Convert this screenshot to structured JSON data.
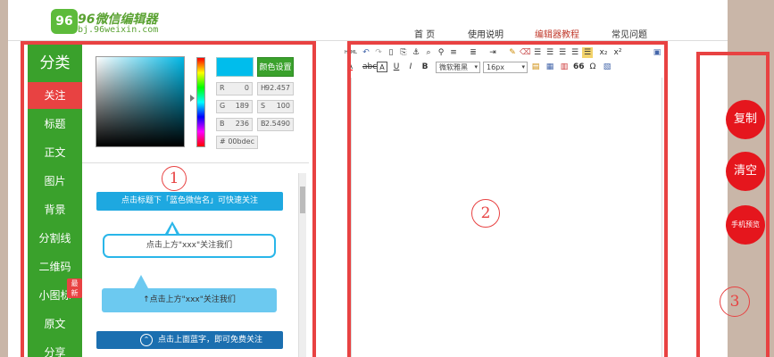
{
  "logo": {
    "main": "96微信编辑器",
    "sub": "bj.96weixin.com",
    "badge": "96"
  },
  "nav": [
    "首 页",
    "使用说明",
    "编辑器教程",
    "常见问题"
  ],
  "categories": {
    "title": "分类",
    "items": [
      "关注",
      "标题",
      "正文",
      "图片",
      "背景",
      "分割线",
      "二维码",
      "小图标",
      "原文",
      "分享"
    ],
    "new_badge": "最新"
  },
  "color_picker": {
    "selected_color": "#00bdec",
    "set_button": "颜色设置",
    "r_label": "R",
    "r_value": "0",
    "g_label": "G",
    "g_value": "189",
    "b_label": "B",
    "b_value": "236",
    "h_label": "H",
    "h_value": "92.457",
    "s_label": "S",
    "s_value": "100",
    "b2_label": "B",
    "b2_value": "2.5490",
    "hex_label": "#",
    "hex_value": "00bdec"
  },
  "templates": {
    "t1": "点击标题下「蓝色微信名」可快速关注",
    "t2": "点击上方\"xxx\"关注我们",
    "t3": "↑点击上方\"xxx\"关注我们",
    "t4": "点击上面蓝字，即可免费关注"
  },
  "toolbar": {
    "font_family": "微软雅黑",
    "font_size": "16px",
    "html_label": "HTML",
    "omega": "Ω",
    "quote": "66",
    "underline": "U",
    "italic": "I",
    "bold": "B",
    "font_color": "A"
  },
  "markers": {
    "m1": "1",
    "m2": "2",
    "m3": "3"
  },
  "actions": {
    "copy": "复制",
    "clear": "清空",
    "preview": "手机预览"
  },
  "colors": {
    "accent_red": "#e84242",
    "green": "#3aa12c",
    "blue": "#1ea8e0"
  }
}
